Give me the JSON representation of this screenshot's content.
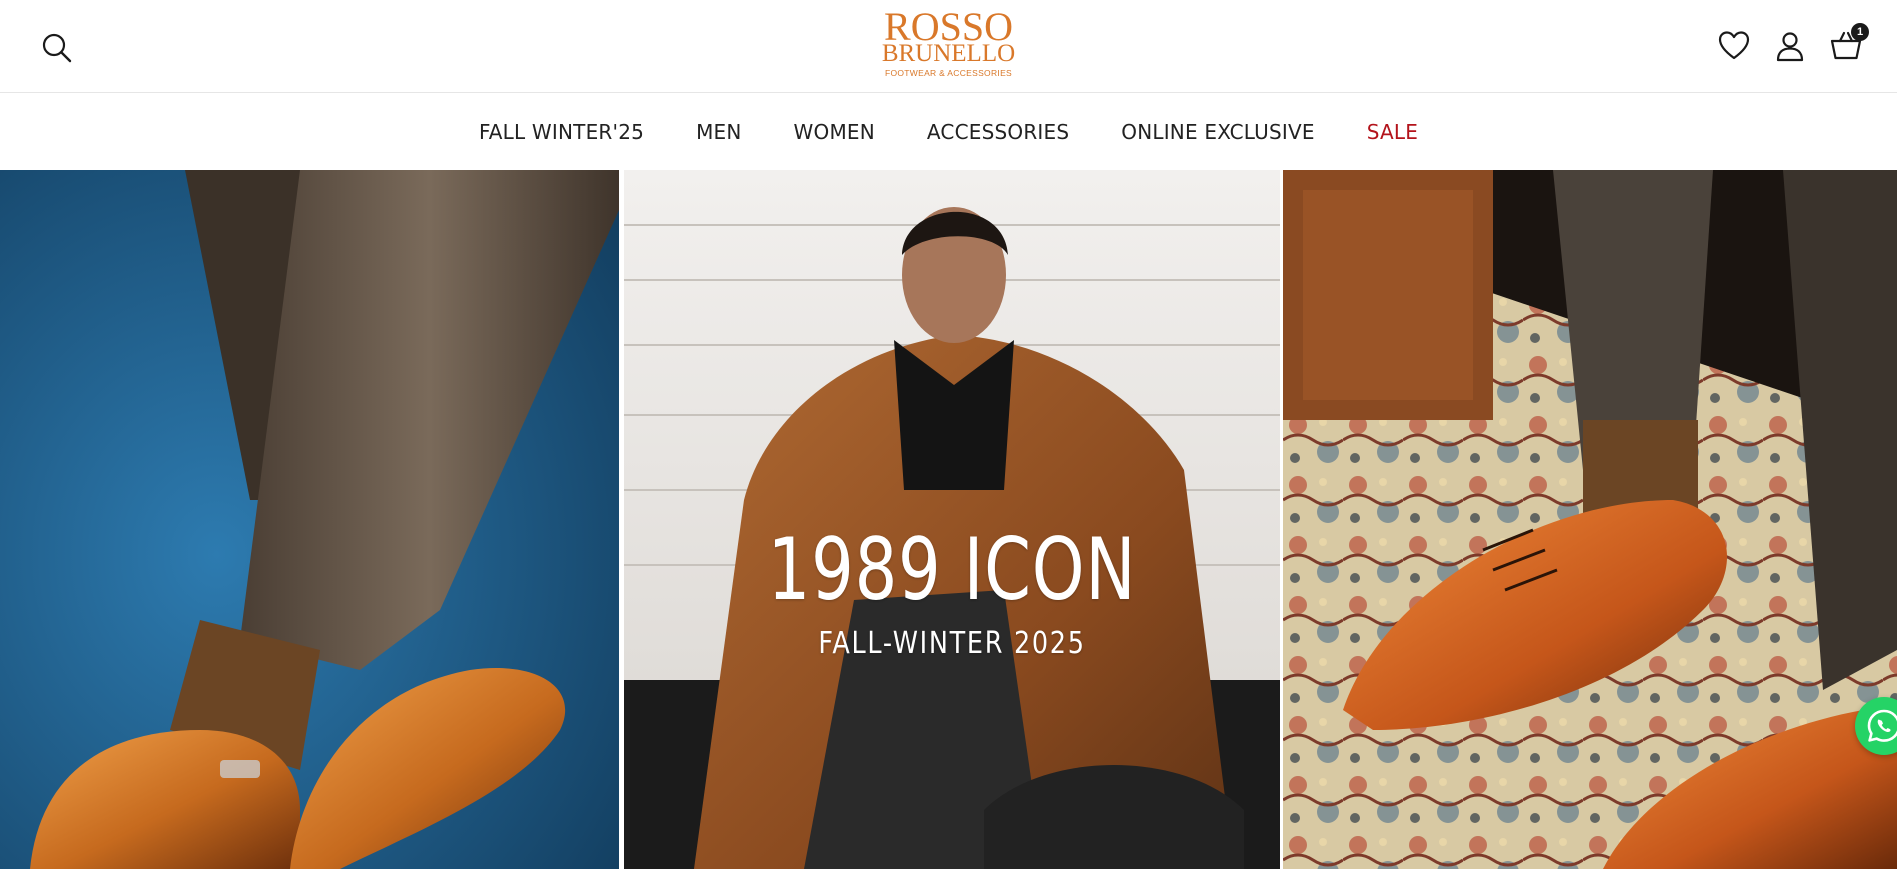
{
  "header": {
    "logo": {
      "line1": "ROSSO",
      "line2": "BRUNELLO",
      "tagline": "FOOTWEAR & ACCESSORIES"
    },
    "icons": {
      "search": "search-icon",
      "wishlist": "heart-icon",
      "account": "user-icon",
      "cart": "basket-icon"
    },
    "cart_count": "1"
  },
  "nav": {
    "items": [
      {
        "label": "FALL WINTER'25"
      },
      {
        "label": "MEN"
      },
      {
        "label": "WOMEN"
      },
      {
        "label": "ACCESSORIES"
      },
      {
        "label": "ONLINE EXCLUSIVE"
      },
      {
        "label": "SALE"
      }
    ]
  },
  "hero": {
    "title": "1989 ICON",
    "subtitle": "FALL-WINTER 2025"
  },
  "colors": {
    "brand": "#d9782a",
    "sale": "#b3131b",
    "whatsapp": "#25d366"
  }
}
